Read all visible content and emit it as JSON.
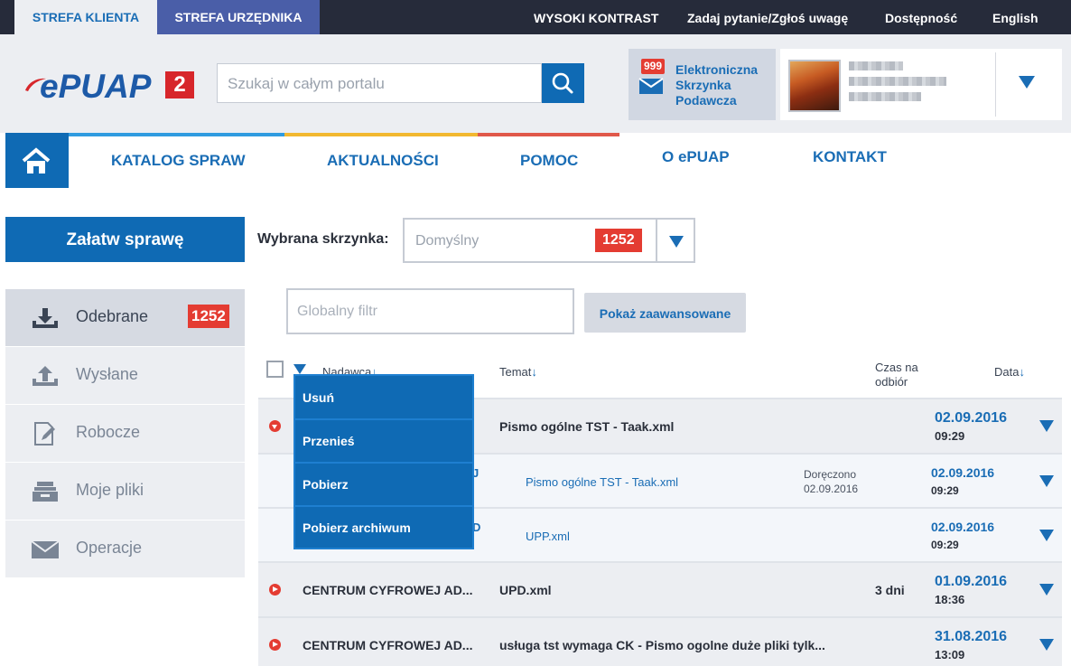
{
  "topbar": {
    "client_zone": "STREFA KLIENTA",
    "official_zone": "STREFA URZĘDNIKA",
    "high_contrast": "WYSOKI KONTRAST",
    "ask_question": "Zadaj pytanie/Zgłoś uwagę",
    "accessibility": "Dostępność",
    "language": "English"
  },
  "header": {
    "logo_text": "ePUAP",
    "logo_badge": "2",
    "search_placeholder": "Szukaj w całym portalu",
    "inbox_badge": "999",
    "inbox_label": "Elektroniczna Skrzynka Podawcza"
  },
  "nav": {
    "items": [
      "KATALOG SPRAW",
      "AKTUALNOŚCI",
      "POMOC",
      "O ePUAP",
      "KONTAKT"
    ],
    "stripe_colors": [
      "#2f9be0",
      "#f2b830",
      "#e0584a"
    ]
  },
  "sidebar": {
    "cta": "Załatw sprawę",
    "items": [
      {
        "label": "Odebrane",
        "badge": "1252",
        "icon": "download-tray-icon"
      },
      {
        "label": "Wysłane",
        "icon": "upload-tray-icon"
      },
      {
        "label": "Robocze",
        "icon": "draft-edit-icon"
      },
      {
        "label": "Moje pliki",
        "icon": "file-drawer-icon"
      },
      {
        "label": "Operacje",
        "icon": "envelope-icon"
      }
    ]
  },
  "mailbox": {
    "label": "Wybrana skrzynka:",
    "value": "Domyślny",
    "count": "1252"
  },
  "filter": {
    "placeholder": "Globalny filtr",
    "advanced_button": "Pokaż zaawansowane"
  },
  "table": {
    "headers": {
      "sender": "Nadawca",
      "subject": "Temat",
      "time_to_collect": "Czas na odbiór",
      "date": "Data",
      "sort_arrow": "↓"
    },
    "rows": [
      {
        "subject": "Pismo ogólne TST - Taak.xml",
        "date": "02.09.2016",
        "time": "09:29"
      },
      {
        "sub": true,
        "sender_fragment": "J",
        "subject": "Pismo ogólne TST - Taak.xml",
        "status_line1": "Doręczono",
        "status_line2": "02.09.2016",
        "date": "02.09.2016",
        "time": "09:29"
      },
      {
        "sub": true,
        "sender_fragment": "D",
        "subject": "UPP.xml",
        "date": "02.09.2016",
        "time": "09:29"
      },
      {
        "sender": "CENTRUM CYFROWEJ AD...",
        "subject": "UPD.xml",
        "time_to_collect": "3 dni",
        "date": "01.09.2016",
        "time": "18:36"
      },
      {
        "sender": "CENTRUM CYFROWEJ AD...",
        "subject": "usługa tst wymaga CK - Pismo ogolne duże pliki tylk...",
        "date": "31.08.2016",
        "time": "13:09"
      }
    ]
  },
  "bulk_menu": {
    "items": [
      "Usuń",
      "Przenieś",
      "Pobierz",
      "Pobierz archiwum"
    ]
  },
  "colors": {
    "primary": "#0f6ab4",
    "badge_red": "#e43c32",
    "topbar": "#262b3a"
  }
}
